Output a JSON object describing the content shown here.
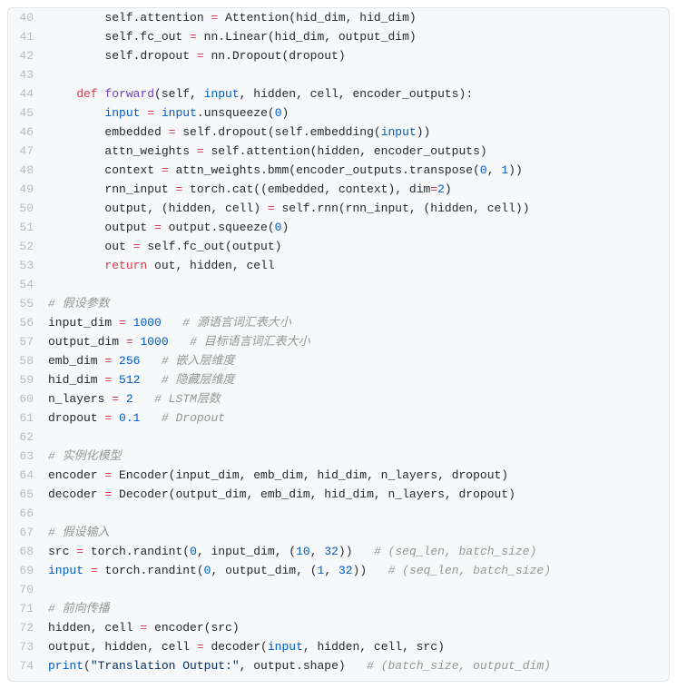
{
  "lines": [
    {
      "no": 40,
      "tokens": [
        {
          "t": "        self.attention ",
          "c": "d"
        },
        {
          "t": "=",
          "c": "k"
        },
        {
          "t": " Attention(hid_dim, hid_dim)",
          "c": "d"
        }
      ]
    },
    {
      "no": 41,
      "tokens": [
        {
          "t": "        self.fc_out ",
          "c": "d"
        },
        {
          "t": "=",
          "c": "k"
        },
        {
          "t": " nn.Linear(hid_dim, output_dim)",
          "c": "d"
        }
      ]
    },
    {
      "no": 42,
      "tokens": [
        {
          "t": "        self.dropout ",
          "c": "d"
        },
        {
          "t": "=",
          "c": "k"
        },
        {
          "t": " nn.Dropout(dropout)",
          "c": "d"
        }
      ]
    },
    {
      "no": 43,
      "tokens": [
        {
          "t": "",
          "c": "d"
        }
      ]
    },
    {
      "no": 44,
      "tokens": [
        {
          "t": "    ",
          "c": "d"
        },
        {
          "t": "def",
          "c": "k"
        },
        {
          "t": " ",
          "c": "d"
        },
        {
          "t": "forward",
          "c": "f"
        },
        {
          "t": "(self, ",
          "c": "d"
        },
        {
          "t": "input",
          "c": "b"
        },
        {
          "t": ", hidden, cell, encoder_outputs):",
          "c": "d"
        }
      ]
    },
    {
      "no": 45,
      "tokens": [
        {
          "t": "        ",
          "c": "d"
        },
        {
          "t": "input",
          "c": "b"
        },
        {
          "t": " ",
          "c": "d"
        },
        {
          "t": "=",
          "c": "k"
        },
        {
          "t": " ",
          "c": "d"
        },
        {
          "t": "input",
          "c": "b"
        },
        {
          "t": ".unsqueeze(",
          "c": "d"
        },
        {
          "t": "0",
          "c": "n"
        },
        {
          "t": ")",
          "c": "d"
        }
      ]
    },
    {
      "no": 46,
      "tokens": [
        {
          "t": "        embedded ",
          "c": "d"
        },
        {
          "t": "=",
          "c": "k"
        },
        {
          "t": " self.dropout(self.embedding(",
          "c": "d"
        },
        {
          "t": "input",
          "c": "b"
        },
        {
          "t": "))",
          "c": "d"
        }
      ]
    },
    {
      "no": 47,
      "tokens": [
        {
          "t": "        attn_weights ",
          "c": "d"
        },
        {
          "t": "=",
          "c": "k"
        },
        {
          "t": " self.attention(hidden, encoder_outputs)",
          "c": "d"
        }
      ]
    },
    {
      "no": 48,
      "tokens": [
        {
          "t": "        context ",
          "c": "d"
        },
        {
          "t": "=",
          "c": "k"
        },
        {
          "t": " attn_weights.bmm(encoder_outputs.transpose(",
          "c": "d"
        },
        {
          "t": "0",
          "c": "n"
        },
        {
          "t": ", ",
          "c": "d"
        },
        {
          "t": "1",
          "c": "n"
        },
        {
          "t": "))",
          "c": "d"
        }
      ]
    },
    {
      "no": 49,
      "tokens": [
        {
          "t": "        rnn_input ",
          "c": "d"
        },
        {
          "t": "=",
          "c": "k"
        },
        {
          "t": " torch.cat((embedded, context), dim",
          "c": "d"
        },
        {
          "t": "=",
          "c": "k"
        },
        {
          "t": "2",
          "c": "n"
        },
        {
          "t": ")",
          "c": "d"
        }
      ]
    },
    {
      "no": 50,
      "tokens": [
        {
          "t": "        output, (hidden, cell) ",
          "c": "d"
        },
        {
          "t": "=",
          "c": "k"
        },
        {
          "t": " self.rnn(rnn_input, (hidden, cell))",
          "c": "d"
        }
      ]
    },
    {
      "no": 51,
      "tokens": [
        {
          "t": "        output ",
          "c": "d"
        },
        {
          "t": "=",
          "c": "k"
        },
        {
          "t": " output.squeeze(",
          "c": "d"
        },
        {
          "t": "0",
          "c": "n"
        },
        {
          "t": ")",
          "c": "d"
        }
      ]
    },
    {
      "no": 52,
      "tokens": [
        {
          "t": "        out ",
          "c": "d"
        },
        {
          "t": "=",
          "c": "k"
        },
        {
          "t": " self.fc_out(output)",
          "c": "d"
        }
      ]
    },
    {
      "no": 53,
      "tokens": [
        {
          "t": "        ",
          "c": "d"
        },
        {
          "t": "return",
          "c": "k"
        },
        {
          "t": " out, hidden, cell",
          "c": "d"
        }
      ]
    },
    {
      "no": 54,
      "tokens": [
        {
          "t": "",
          "c": "d"
        }
      ]
    },
    {
      "no": 55,
      "tokens": [
        {
          "t": "# 假设参数",
          "c": "c"
        }
      ]
    },
    {
      "no": 56,
      "tokens": [
        {
          "t": "input_dim ",
          "c": "d"
        },
        {
          "t": "=",
          "c": "k"
        },
        {
          "t": " ",
          "c": "d"
        },
        {
          "t": "1000",
          "c": "n"
        },
        {
          "t": "   ",
          "c": "d"
        },
        {
          "t": "# 源语言词汇表大小",
          "c": "c"
        }
      ]
    },
    {
      "no": 57,
      "tokens": [
        {
          "t": "output_dim ",
          "c": "d"
        },
        {
          "t": "=",
          "c": "k"
        },
        {
          "t": " ",
          "c": "d"
        },
        {
          "t": "1000",
          "c": "n"
        },
        {
          "t": "   ",
          "c": "d"
        },
        {
          "t": "# 目标语言词汇表大小",
          "c": "c"
        }
      ]
    },
    {
      "no": 58,
      "tokens": [
        {
          "t": "emb_dim ",
          "c": "d"
        },
        {
          "t": "=",
          "c": "k"
        },
        {
          "t": " ",
          "c": "d"
        },
        {
          "t": "256",
          "c": "n"
        },
        {
          "t": "   ",
          "c": "d"
        },
        {
          "t": "# 嵌入层维度",
          "c": "c"
        }
      ]
    },
    {
      "no": 59,
      "tokens": [
        {
          "t": "hid_dim ",
          "c": "d"
        },
        {
          "t": "=",
          "c": "k"
        },
        {
          "t": " ",
          "c": "d"
        },
        {
          "t": "512",
          "c": "n"
        },
        {
          "t": "   ",
          "c": "d"
        },
        {
          "t": "# 隐藏层维度",
          "c": "c"
        }
      ]
    },
    {
      "no": 60,
      "tokens": [
        {
          "t": "n_layers ",
          "c": "d"
        },
        {
          "t": "=",
          "c": "k"
        },
        {
          "t": " ",
          "c": "d"
        },
        {
          "t": "2",
          "c": "n"
        },
        {
          "t": "   ",
          "c": "d"
        },
        {
          "t": "# LSTM层数",
          "c": "c"
        }
      ]
    },
    {
      "no": 61,
      "tokens": [
        {
          "t": "dropout ",
          "c": "d"
        },
        {
          "t": "=",
          "c": "k"
        },
        {
          "t": " ",
          "c": "d"
        },
        {
          "t": "0.1",
          "c": "n"
        },
        {
          "t": "   ",
          "c": "d"
        },
        {
          "t": "# Dropout",
          "c": "c"
        }
      ]
    },
    {
      "no": 62,
      "tokens": [
        {
          "t": "",
          "c": "d"
        }
      ]
    },
    {
      "no": 63,
      "tokens": [
        {
          "t": "# 实例化模型",
          "c": "c"
        }
      ]
    },
    {
      "no": 64,
      "tokens": [
        {
          "t": "encoder ",
          "c": "d"
        },
        {
          "t": "=",
          "c": "k"
        },
        {
          "t": " Encoder(input_dim, emb_dim, hid_dim, n_layers, dropout)",
          "c": "d"
        }
      ]
    },
    {
      "no": 65,
      "tokens": [
        {
          "t": "decoder ",
          "c": "d"
        },
        {
          "t": "=",
          "c": "k"
        },
        {
          "t": " Decoder(output_dim, emb_dim, hid_dim, n_layers, dropout)",
          "c": "d"
        }
      ]
    },
    {
      "no": 66,
      "tokens": [
        {
          "t": "",
          "c": "d"
        }
      ]
    },
    {
      "no": 67,
      "tokens": [
        {
          "t": "# 假设输入",
          "c": "c"
        }
      ]
    },
    {
      "no": 68,
      "tokens": [
        {
          "t": "src ",
          "c": "d"
        },
        {
          "t": "=",
          "c": "k"
        },
        {
          "t": " torch.randint(",
          "c": "d"
        },
        {
          "t": "0",
          "c": "n"
        },
        {
          "t": ", input_dim, (",
          "c": "d"
        },
        {
          "t": "10",
          "c": "n"
        },
        {
          "t": ", ",
          "c": "d"
        },
        {
          "t": "32",
          "c": "n"
        },
        {
          "t": "))   ",
          "c": "d"
        },
        {
          "t": "# (seq_len, batch_size)",
          "c": "c"
        }
      ]
    },
    {
      "no": 69,
      "tokens": [
        {
          "t": "input",
          "c": "b"
        },
        {
          "t": " ",
          "c": "d"
        },
        {
          "t": "=",
          "c": "k"
        },
        {
          "t": " torch.randint(",
          "c": "d"
        },
        {
          "t": "0",
          "c": "n"
        },
        {
          "t": ", output_dim, (",
          "c": "d"
        },
        {
          "t": "1",
          "c": "n"
        },
        {
          "t": ", ",
          "c": "d"
        },
        {
          "t": "32",
          "c": "n"
        },
        {
          "t": "))   ",
          "c": "d"
        },
        {
          "t": "# (seq_len, batch_size)",
          "c": "c"
        }
      ]
    },
    {
      "no": 70,
      "tokens": [
        {
          "t": "",
          "c": "d"
        }
      ]
    },
    {
      "no": 71,
      "tokens": [
        {
          "t": "# 前向传播",
          "c": "c"
        }
      ]
    },
    {
      "no": 72,
      "tokens": [
        {
          "t": "hidden, cell ",
          "c": "d"
        },
        {
          "t": "=",
          "c": "k"
        },
        {
          "t": " encoder(src)",
          "c": "d"
        }
      ]
    },
    {
      "no": 73,
      "tokens": [
        {
          "t": "output, hidden, cell ",
          "c": "d"
        },
        {
          "t": "=",
          "c": "k"
        },
        {
          "t": " decoder(",
          "c": "d"
        },
        {
          "t": "input",
          "c": "b"
        },
        {
          "t": ", hidden, cell, src)",
          "c": "d"
        }
      ]
    },
    {
      "no": 74,
      "tokens": [
        {
          "t": "print",
          "c": "b"
        },
        {
          "t": "(",
          "c": "d"
        },
        {
          "t": "\"Translation Output:\"",
          "c": "s"
        },
        {
          "t": ", output.shape)   ",
          "c": "d"
        },
        {
          "t": "# (batch_size, output_dim)",
          "c": "c"
        }
      ]
    }
  ]
}
